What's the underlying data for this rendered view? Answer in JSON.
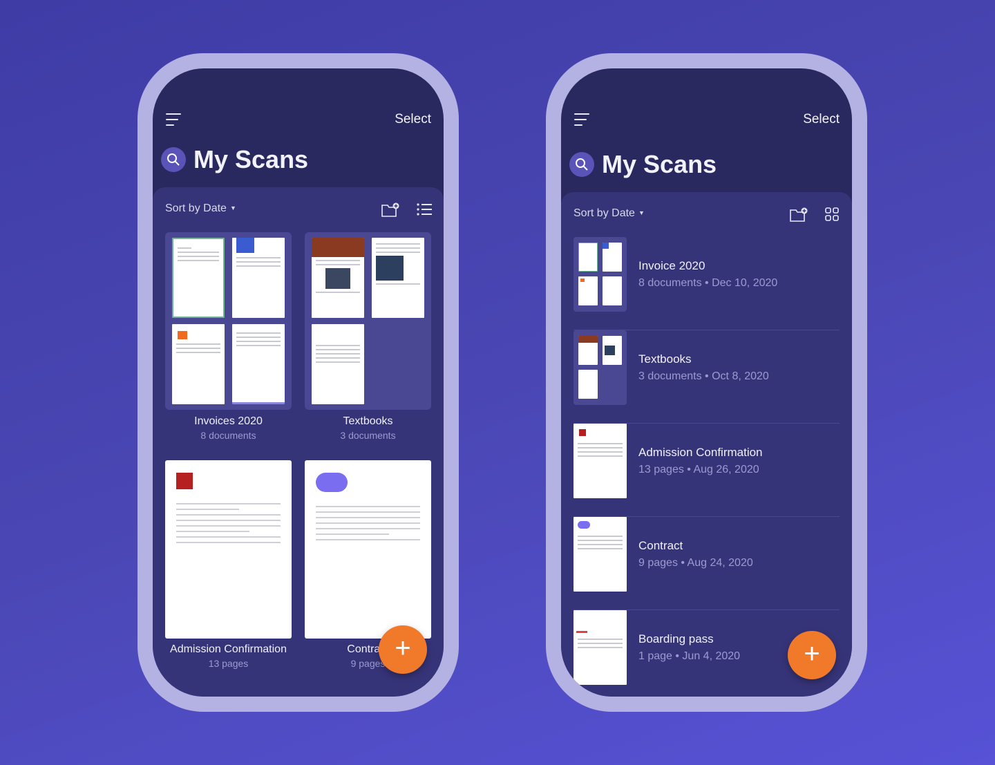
{
  "colors": {
    "background": "#4a47b4",
    "frame": "#b4b2e2",
    "screen": "#29285f",
    "panel": "#363478",
    "fab": "#f07a2a"
  },
  "grid_view": {
    "select_label": "Select",
    "title": "My Scans",
    "sort_label": "Sort by Date",
    "icons": [
      "menu-icon",
      "search-icon",
      "new-folder-icon",
      "list-view-icon",
      "plus-icon"
    ],
    "cards": [
      {
        "title": "Invoices 2020",
        "subtitle": "8 documents"
      },
      {
        "title": "Textbooks",
        "subtitle": "3 documents"
      },
      {
        "title": "Admission Confirmation",
        "subtitle": "13 pages"
      },
      {
        "title": "Contract",
        "subtitle": "9 pages"
      }
    ],
    "fab": "+"
  },
  "list_view": {
    "select_label": "Select",
    "title": "My Scans",
    "sort_label": "Sort by Date",
    "icons": [
      "menu-icon",
      "search-icon",
      "new-folder-icon",
      "grid-view-icon",
      "plus-icon"
    ],
    "items": [
      {
        "title": "Invoice 2020",
        "subtitle": "8 documents • Dec 10, 2020"
      },
      {
        "title": "Textbooks",
        "subtitle": "3 documents • Oct 8, 2020"
      },
      {
        "title": "Admission Confirmation",
        "subtitle": "13 pages • Aug 26, 2020"
      },
      {
        "title": "Contract",
        "subtitle": "9 pages • Aug 24, 2020"
      },
      {
        "title": "Boarding pass",
        "subtitle": "1 page • Jun 4, 2020"
      }
    ],
    "fab": "+"
  }
}
